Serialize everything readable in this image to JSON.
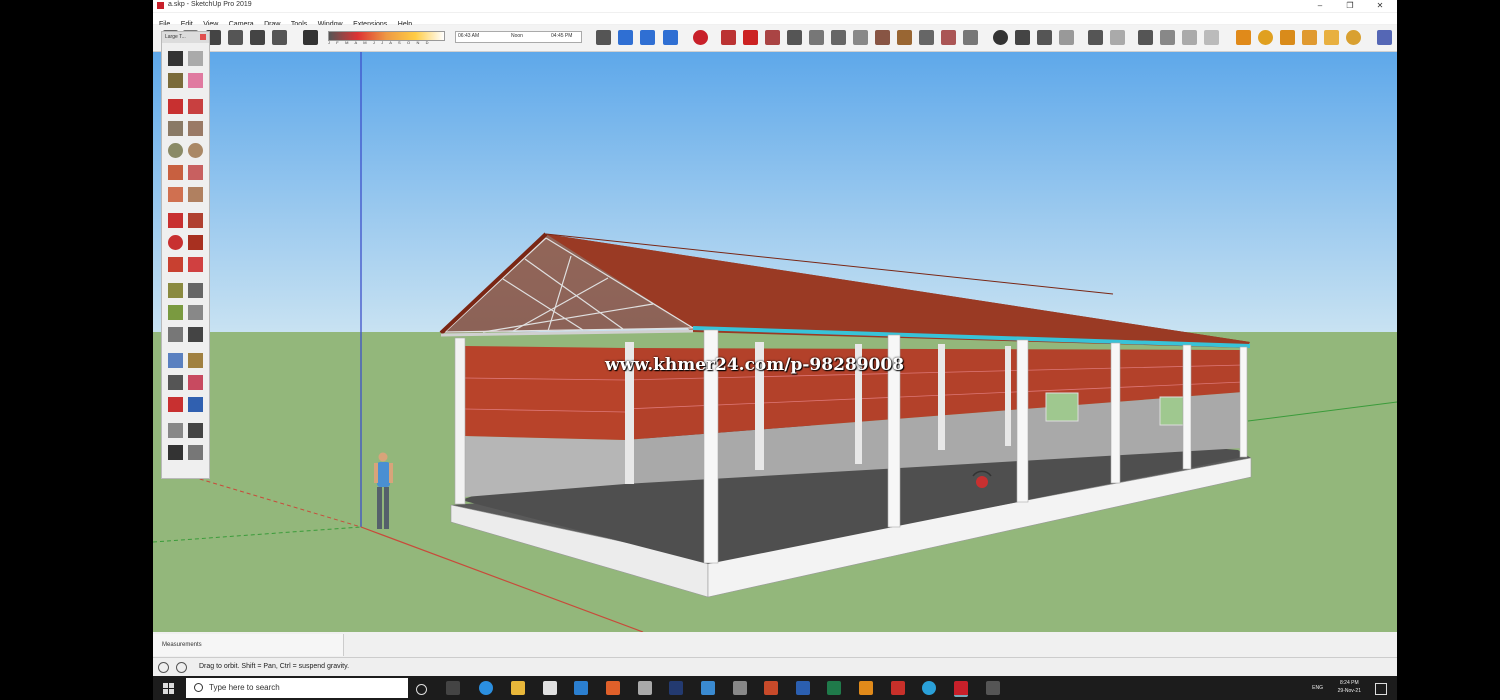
{
  "window": {
    "title": "a.skp - SketchUp Pro 2019",
    "controls": [
      "–",
      "❐",
      "✕"
    ]
  },
  "menu": [
    "File",
    "Edit",
    "View",
    "Camera",
    "Draw",
    "Tools",
    "Window",
    "Extensions",
    "Help"
  ],
  "toolbar": {
    "shadow_months": "J F M A M J J A S O N D",
    "time_start": "06:43 AM",
    "time_mid": "Noon",
    "time_end": "04:45 PM"
  },
  "palette": {
    "title": "Large T..."
  },
  "viewport": {
    "watermark": "www.khmer24.com/p-98289008"
  },
  "measurements": {
    "label": "Measurements"
  },
  "status": {
    "hint": "Drag to orbit. Shift = Pan, Ctrl = suspend gravity."
  },
  "taskbar": {
    "search_placeholder": "Type here to search",
    "language": "ENG",
    "time": "8:24 PM",
    "date": "29-Nov-21"
  },
  "colors": {
    "sky_top": "#5fa9ea",
    "sky_bottom": "#c9e3f2",
    "ground": "#93b77b",
    "roof": "#9e3a25",
    "wall_panel": "#b9442b",
    "gutter": "#38c3d8",
    "taskbar": "#1c1c1c"
  }
}
